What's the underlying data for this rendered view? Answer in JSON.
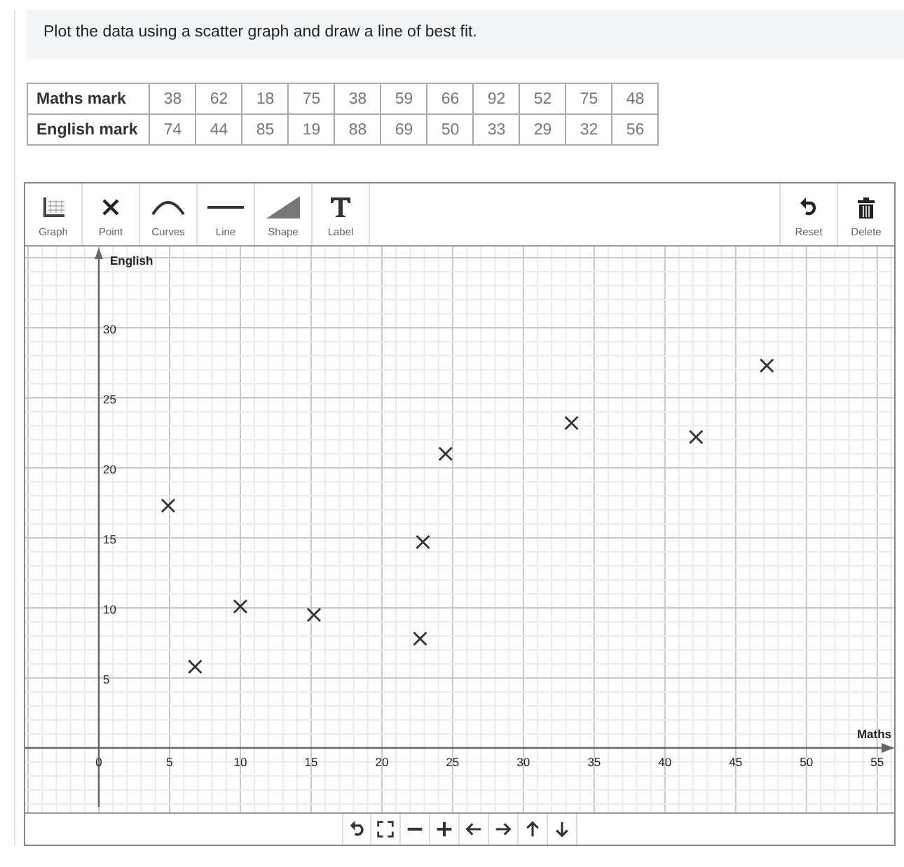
{
  "prompt": "Plot the data using a scatter graph and draw a line of best fit.",
  "table": {
    "rows": [
      {
        "header": "Maths mark",
        "cells": [
          "38",
          "62",
          "18",
          "75",
          "38",
          "59",
          "66",
          "92",
          "52",
          "75",
          "48"
        ]
      },
      {
        "header": "English mark",
        "cells": [
          "74",
          "44",
          "85",
          "19",
          "88",
          "69",
          "50",
          "33",
          "29",
          "32",
          "56"
        ]
      }
    ]
  },
  "toolbar": {
    "tools": [
      {
        "kind": "graph",
        "label": "Graph"
      },
      {
        "kind": "point",
        "label": "Point"
      },
      {
        "kind": "curves",
        "label": "Curves"
      },
      {
        "kind": "line",
        "label": "Line"
      },
      {
        "kind": "shape",
        "label": "Shape"
      },
      {
        "kind": "label",
        "label": "Label"
      }
    ],
    "actions": [
      {
        "kind": "reset",
        "label": "Reset"
      },
      {
        "kind": "delete",
        "label": "Delete"
      }
    ]
  },
  "graph": {
    "chart_data": {
      "type": "scatter",
      "xlabel": "Maths",
      "ylabel": "English",
      "xlim": [
        -5.2,
        56.2
      ],
      "ylim": [
        -4.6,
        35.8
      ],
      "xticks": [
        0,
        5,
        10,
        15,
        20,
        25,
        30,
        35,
        40,
        45,
        50,
        55
      ],
      "yticks": [
        5,
        10,
        15,
        20,
        25,
        30
      ],
      "x": [
        4.9,
        6.8,
        10,
        15.2,
        22.7,
        22.9,
        24.5,
        33.4,
        42.2,
        47.2
      ],
      "grid": true,
      "series": [
        {
          "values": [
            17.3,
            5.8,
            10.1,
            9.5,
            7.8,
            14.7,
            21,
            23.2,
            22.2,
            27.3
          ]
        }
      ]
    }
  },
  "navigation": [
    {
      "kind": "undo"
    },
    {
      "kind": "fit"
    },
    {
      "kind": "zoom-out"
    },
    {
      "kind": "zoom-in"
    },
    {
      "kind": "left"
    },
    {
      "kind": "right"
    },
    {
      "kind": "up"
    },
    {
      "kind": "down"
    }
  ]
}
